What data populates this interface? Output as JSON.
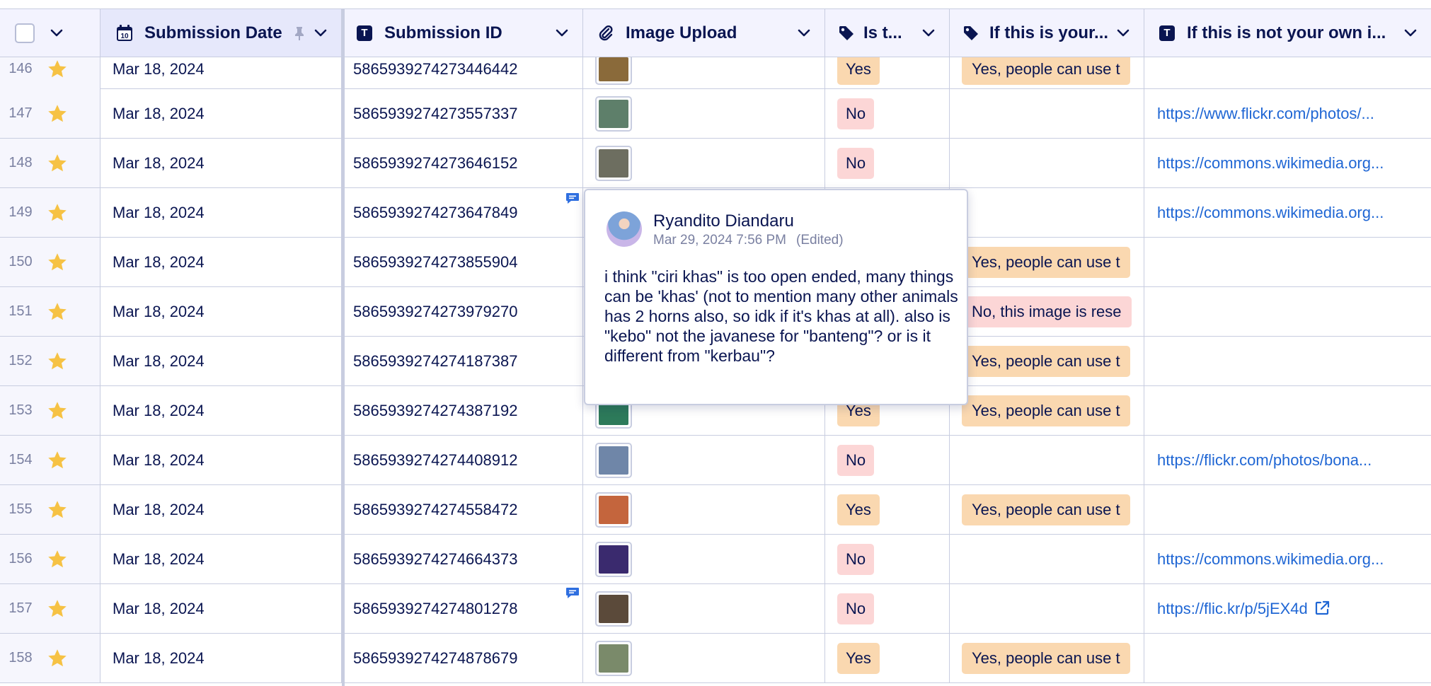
{
  "header": {
    "select_all_label": "",
    "columns": [
      {
        "label": "Submission Date",
        "icon": "calendar-icon"
      },
      {
        "label": "Submission ID",
        "icon": "text-icon"
      },
      {
        "label": "Image Upload",
        "icon": "paperclip-icon"
      },
      {
        "label": "Is t...",
        "icon": "tag-icon"
      },
      {
        "label": "If this is your...",
        "icon": "tag-icon"
      },
      {
        "label": "If this is not your own i...",
        "icon": "text-icon"
      }
    ]
  },
  "rows": [
    {
      "num": "146",
      "date": "Mar 18, 2024",
      "id": "5865939274273446442",
      "is": "Yes",
      "perm": "Yes, people can use t",
      "url": "",
      "thumb": "#8a6a3a"
    },
    {
      "num": "147",
      "date": "Mar 18, 2024",
      "id": "5865939274273557337",
      "is": "No",
      "perm": "",
      "url": "https://www.flickr.com/photos/...",
      "thumb": "#5e7f6a"
    },
    {
      "num": "148",
      "date": "Mar 18, 2024",
      "id": "5865939274273646152",
      "is": "No",
      "perm": "",
      "url": "https://commons.wikimedia.org...",
      "thumb": "#6d6e60"
    },
    {
      "num": "149",
      "date": "Mar 18, 2024",
      "id": "5865939274273647849",
      "is": "",
      "perm": "",
      "url": "https://commons.wikimedia.org...",
      "thumb": ""
    },
    {
      "num": "150",
      "date": "Mar 18, 2024",
      "id": "5865939274273855904",
      "is": "",
      "perm": "Yes, people can use t",
      "url": "",
      "thumb": ""
    },
    {
      "num": "151",
      "date": "Mar 18, 2024",
      "id": "5865939274273979270",
      "is": "",
      "perm": "No, this image is rese",
      "url": "",
      "thumb": ""
    },
    {
      "num": "152",
      "date": "Mar 18, 2024",
      "id": "5865939274274187387",
      "is": "",
      "perm": "Yes, people can use t",
      "url": "",
      "thumb": ""
    },
    {
      "num": "153",
      "date": "Mar 18, 2024",
      "id": "5865939274274387192",
      "is": "Yes",
      "perm": "Yes, people can use t",
      "url": "",
      "thumb": "#2d7a5a"
    },
    {
      "num": "154",
      "date": "Mar 18, 2024",
      "id": "5865939274274408912",
      "is": "No",
      "perm": "",
      "url": "https://flickr.com/photos/bona...",
      "thumb": "#6f86a8"
    },
    {
      "num": "155",
      "date": "Mar 18, 2024",
      "id": "5865939274274558472",
      "is": "Yes",
      "perm": "Yes, people can use t",
      "url": "",
      "thumb": "#c4653d"
    },
    {
      "num": "156",
      "date": "Mar 18, 2024",
      "id": "5865939274274664373",
      "is": "No",
      "perm": "",
      "url": "https://commons.wikimedia.org...",
      "thumb": "#3a2a6e"
    },
    {
      "num": "157",
      "date": "Mar 18, 2024",
      "id": "5865939274274801278",
      "is": "No",
      "perm": "",
      "url": "https://flic.kr/p/5jEX4d",
      "thumb": "#5b4a3a"
    },
    {
      "num": "158",
      "date": "Mar 18, 2024",
      "id": "5865939274274878679",
      "is": "Yes",
      "perm": "Yes, people can use t",
      "url": "",
      "thumb": "#7a8a6a"
    }
  ],
  "popup": {
    "author": "Ryandito Diandaru",
    "date": "Mar 29, 2024 7:56 PM",
    "edited": "(Edited)",
    "text": "i think \"ciri khas\" is too open ended, many things can be 'khas' (not to mention many other animals has 2 horns also, so idk if it's khas at all). also is \"kebo\" not the javanese for \"banteng\"? or is it different from \"kerbau\"?"
  },
  "colors": {
    "accent_link": "#1f66d4",
    "star": "#f6c244",
    "yes_pill": "#fad8b0",
    "no_pill": "#fcd6d6",
    "header_bg": "#f3f3fe"
  }
}
